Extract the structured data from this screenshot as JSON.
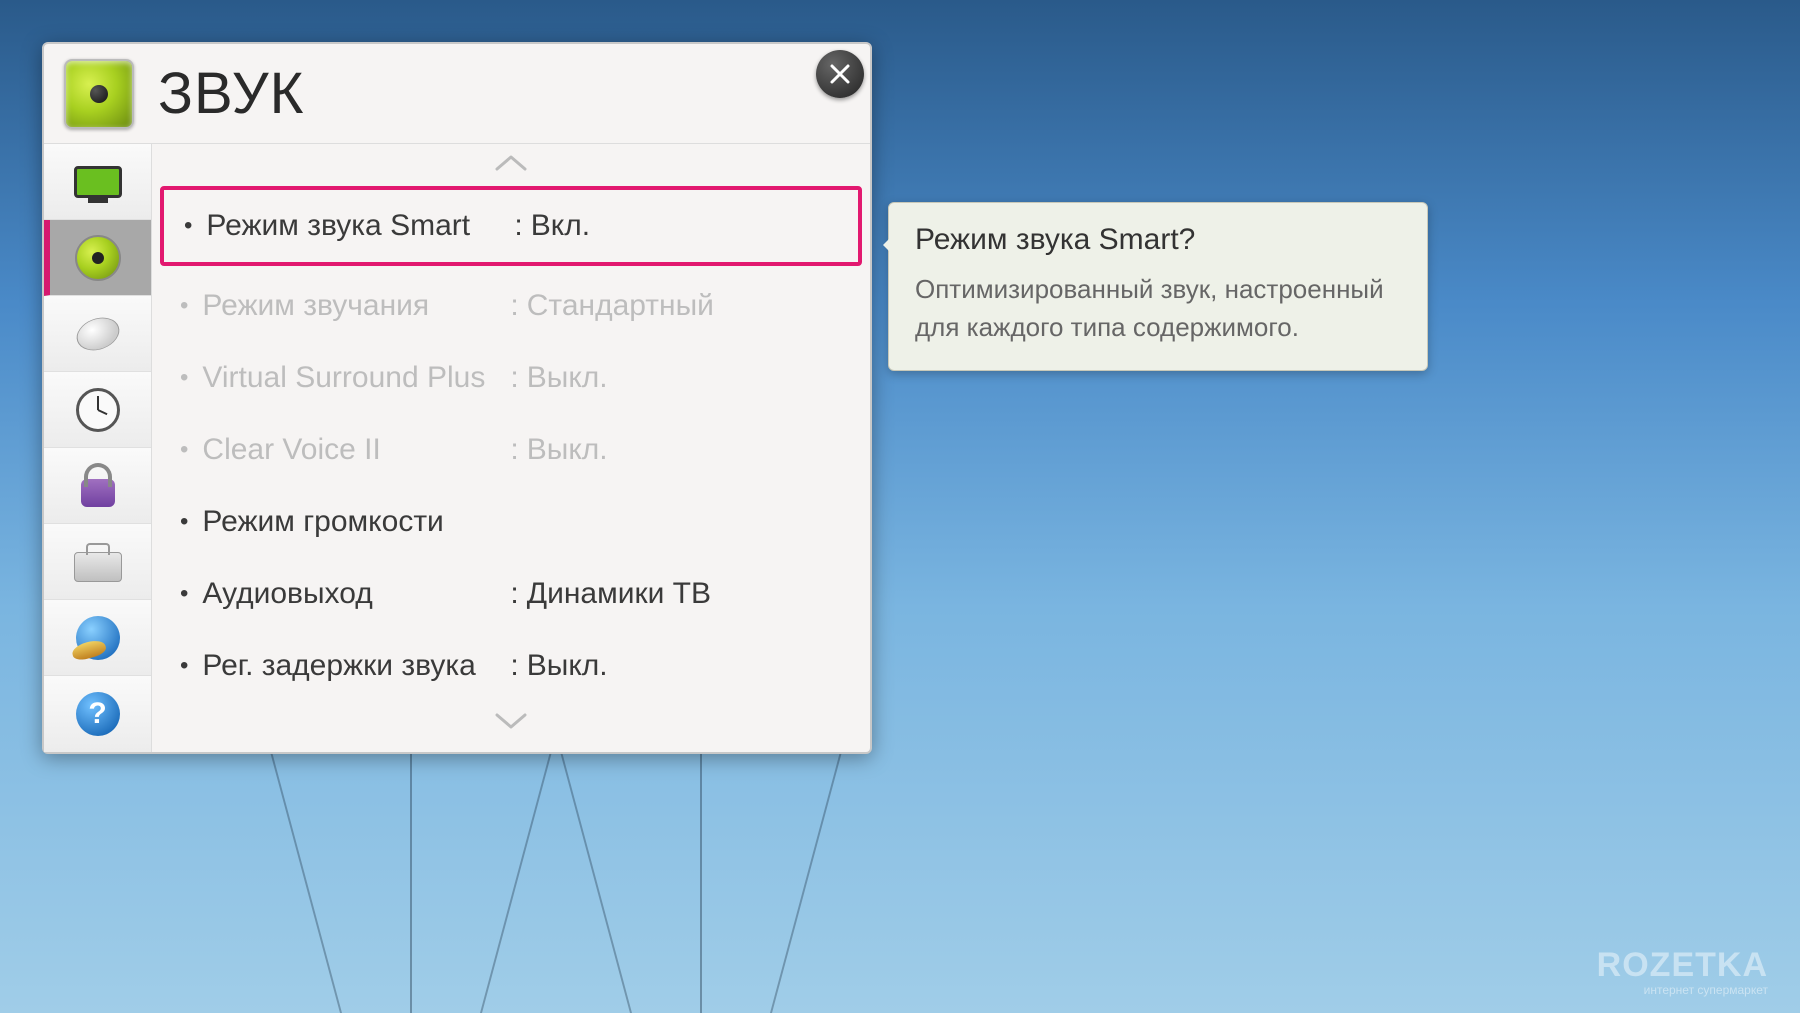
{
  "header": {
    "title": "ЗВУК",
    "icon": "speaker-icon"
  },
  "sidebar": {
    "items": [
      {
        "id": "picture",
        "icon": "monitor-icon",
        "active": false
      },
      {
        "id": "sound",
        "icon": "speaker-icon",
        "active": true
      },
      {
        "id": "channel",
        "icon": "satellite-icon",
        "active": false
      },
      {
        "id": "time",
        "icon": "clock-icon",
        "active": false
      },
      {
        "id": "lock",
        "icon": "lock-icon",
        "active": false
      },
      {
        "id": "option",
        "icon": "toolbox-icon",
        "active": false
      },
      {
        "id": "network",
        "icon": "globe-icon",
        "active": false
      },
      {
        "id": "support",
        "icon": "help-icon",
        "active": false
      }
    ]
  },
  "options": [
    {
      "label": "Режим звука Smart",
      "value": "Вкл.",
      "disabled": false,
      "selected": true
    },
    {
      "label": "Режим звучания",
      "value": "Стандартный",
      "disabled": true,
      "selected": false
    },
    {
      "label": "Virtual Surround Plus",
      "value": "Выкл.",
      "disabled": true,
      "selected": false
    },
    {
      "label": "Clear Voice II",
      "value": "Выкл.",
      "disabled": true,
      "selected": false
    },
    {
      "label": "Режим громкости",
      "value": "",
      "disabled": false,
      "selected": false
    },
    {
      "label": "Аудиовыход",
      "value": "Динамики ТВ",
      "disabled": false,
      "selected": false
    },
    {
      "label": "Рег. задержки звука",
      "value": "Выкл.",
      "disabled": false,
      "selected": false
    }
  ],
  "tooltip": {
    "title": "Режим звука Smart?",
    "body": "Оптимизированный звук, настроенный для каждого типа содержимого."
  },
  "watermark": {
    "main": "ROZETKA",
    "sub": "интернет супермаркет"
  },
  "colors": {
    "accent": "#e2186f",
    "accent_green": "#a8d020"
  }
}
